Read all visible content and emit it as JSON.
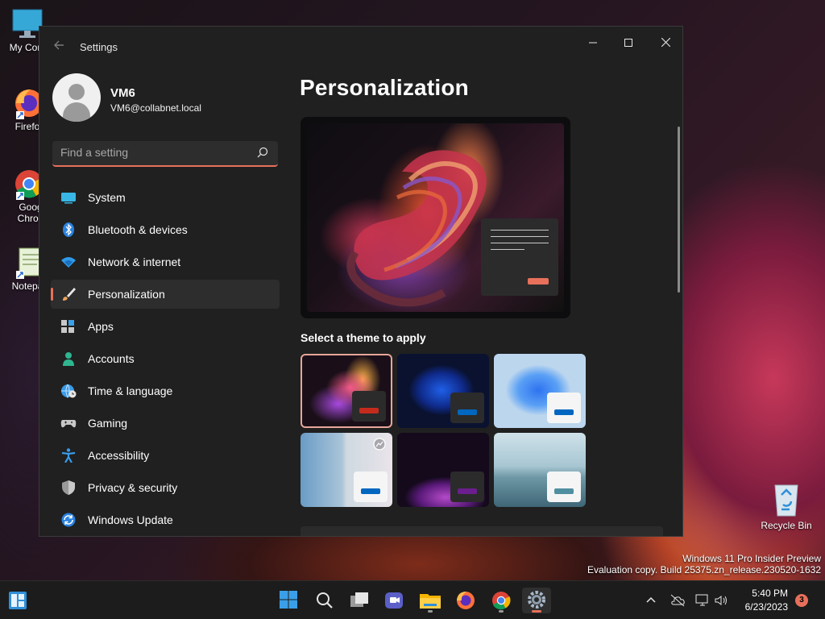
{
  "desktop": {
    "icons": [
      {
        "label": "My Com"
      },
      {
        "label": "Firefo"
      },
      {
        "label": "Goog Chron"
      },
      {
        "label": "Notepa"
      }
    ],
    "recycle_bin": "Recycle Bin",
    "watermark_line1": "Windows 11 Pro Insider Preview",
    "watermark_line2": "Evaluation copy. Build 25375.zn_release.230520-1632"
  },
  "window": {
    "title": "Settings",
    "controls": {
      "minimize": "—",
      "maximize": "☐",
      "close": "✕"
    }
  },
  "profile": {
    "name": "VM6",
    "email": "VM6@collabnet.local"
  },
  "search": {
    "placeholder": "Find a setting"
  },
  "sidebar": {
    "items": [
      {
        "label": "System",
        "icon": "system-icon",
        "active": false
      },
      {
        "label": "Bluetooth & devices",
        "icon": "bluetooth-icon",
        "active": false
      },
      {
        "label": "Network & internet",
        "icon": "wifi-icon",
        "active": false
      },
      {
        "label": "Personalization",
        "icon": "brush-icon",
        "active": true
      },
      {
        "label": "Apps",
        "icon": "apps-icon",
        "active": false
      },
      {
        "label": "Accounts",
        "icon": "person-icon",
        "active": false
      },
      {
        "label": "Time & language",
        "icon": "globe-clock-icon",
        "active": false
      },
      {
        "label": "Gaming",
        "icon": "gamepad-icon",
        "active": false
      },
      {
        "label": "Accessibility",
        "icon": "accessibility-icon",
        "active": false
      },
      {
        "label": "Privacy & security",
        "icon": "shield-icon",
        "active": false
      },
      {
        "label": "Windows Update",
        "icon": "update-icon",
        "active": false
      }
    ]
  },
  "main": {
    "title": "Personalization",
    "theme_heading": "Select a theme to apply",
    "themes": [
      {
        "name": "theme-glow-dark",
        "selected": true,
        "accent": "#c42b1c"
      },
      {
        "name": "theme-bloom-dark",
        "selected": false,
        "accent": "#0067c0"
      },
      {
        "name": "theme-bloom-light",
        "selected": false,
        "accent": "#0067c0"
      },
      {
        "name": "theme-spotlight",
        "selected": false,
        "accent": "#0067c0"
      },
      {
        "name": "theme-sunrise",
        "selected": false,
        "accent": "#6b1e8e"
      },
      {
        "name": "theme-flow",
        "selected": false,
        "accent": "#4f8fa0"
      }
    ]
  },
  "taskbar": {
    "apps": [
      "widgets-icon",
      "start-icon",
      "search-icon",
      "task-view-icon",
      "chat-icon",
      "file-explorer-icon",
      "firefox-icon",
      "chrome-icon",
      "settings-icon"
    ],
    "time": "5:40 PM",
    "date": "6/23/2023",
    "notification_count": "3"
  },
  "colors": {
    "accent": "#e8705b",
    "window_bg": "#202020",
    "nav_active_bg": "#2d2d2d"
  }
}
